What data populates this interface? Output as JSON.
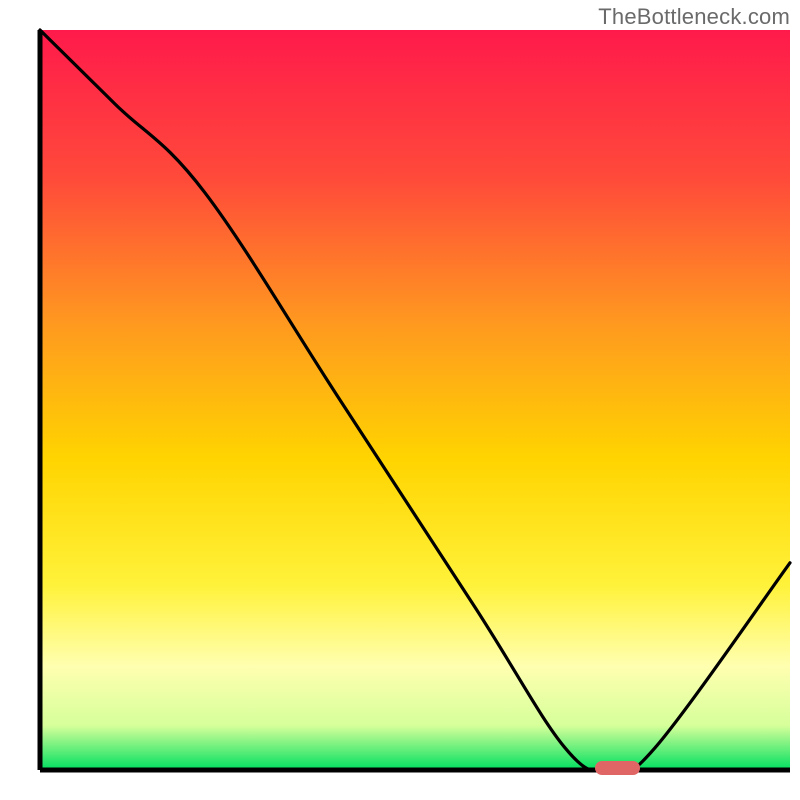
{
  "attribution": "TheBottleneck.com",
  "chart_data": {
    "type": "line",
    "title": "",
    "xlabel": "",
    "ylabel": "",
    "x_range": [
      0,
      100
    ],
    "y_range_bottleneck_pct": [
      0,
      100
    ],
    "series": [
      {
        "name": "bottleneck-curve",
        "x": [
          0,
          10,
          22,
          40,
          58,
          70,
          76,
          82,
          100
        ],
        "y": [
          100,
          90,
          78,
          50,
          22,
          3,
          0,
          3,
          28
        ]
      }
    ],
    "optimal_marker": {
      "x_start": 74,
      "x_end": 80,
      "y": 0
    },
    "background_gradient": {
      "stops": [
        {
          "offset": 0.0,
          "color": "#ff1a4b"
        },
        {
          "offset": 0.2,
          "color": "#ff4a3a"
        },
        {
          "offset": 0.4,
          "color": "#ff9a1f"
        },
        {
          "offset": 0.58,
          "color": "#ffd400"
        },
        {
          "offset": 0.75,
          "color": "#fff23a"
        },
        {
          "offset": 0.86,
          "color": "#ffffb0"
        },
        {
          "offset": 0.94,
          "color": "#d6ff9a"
        },
        {
          "offset": 1.0,
          "color": "#00e060"
        }
      ]
    },
    "colors": {
      "curve": "#000000",
      "axis": "#000000",
      "marker": "#e06666"
    }
  }
}
